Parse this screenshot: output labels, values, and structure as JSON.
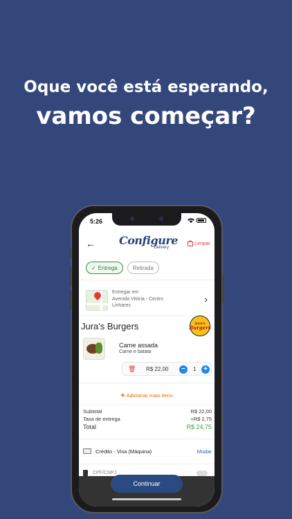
{
  "headline": {
    "line1": "Oque você está esperando,",
    "line2": "vamos começar?"
  },
  "status_bar": {
    "time": "5:26"
  },
  "app": {
    "brand": "Configure",
    "brand_sub": "Delivery",
    "clear_label": "Limpar"
  },
  "order_type": {
    "options": [
      {
        "label": "Entrega",
        "selected": true
      },
      {
        "label": "Retirada",
        "selected": false
      }
    ]
  },
  "address": {
    "label": "Entregar em",
    "line1": "Avenida Vitória - Centro",
    "line2": "Linhares"
  },
  "store": {
    "name": "Jura's Burgers",
    "logo_line1": "Jura's",
    "logo_line2": "Burgers"
  },
  "cart_item": {
    "name": "Carne assada",
    "description": "Carne e batata",
    "price": "R$ 22,00",
    "quantity": "1"
  },
  "add_more_label": "Adicionar mais itens",
  "summary": {
    "subtotal_label": "Subtotal",
    "subtotal_value": "R$ 22,00",
    "fee_label": "Taxa de entrega",
    "fee_value": "+R$ 2,75",
    "total_label": "Total",
    "total_value": "R$ 24,75"
  },
  "payment": {
    "method": "Crédito - Visa (Máquina)",
    "change_label": "Mudar"
  },
  "cpf_label": "CPF/CNPJ",
  "continue_label": "Continuar",
  "colors": {
    "background": "#34477a",
    "brand": "#2c3f7a",
    "accent_green": "#43a047",
    "accent_red": "#e53935",
    "accent_orange": "#ef6c00",
    "button": "#2c4a82"
  }
}
